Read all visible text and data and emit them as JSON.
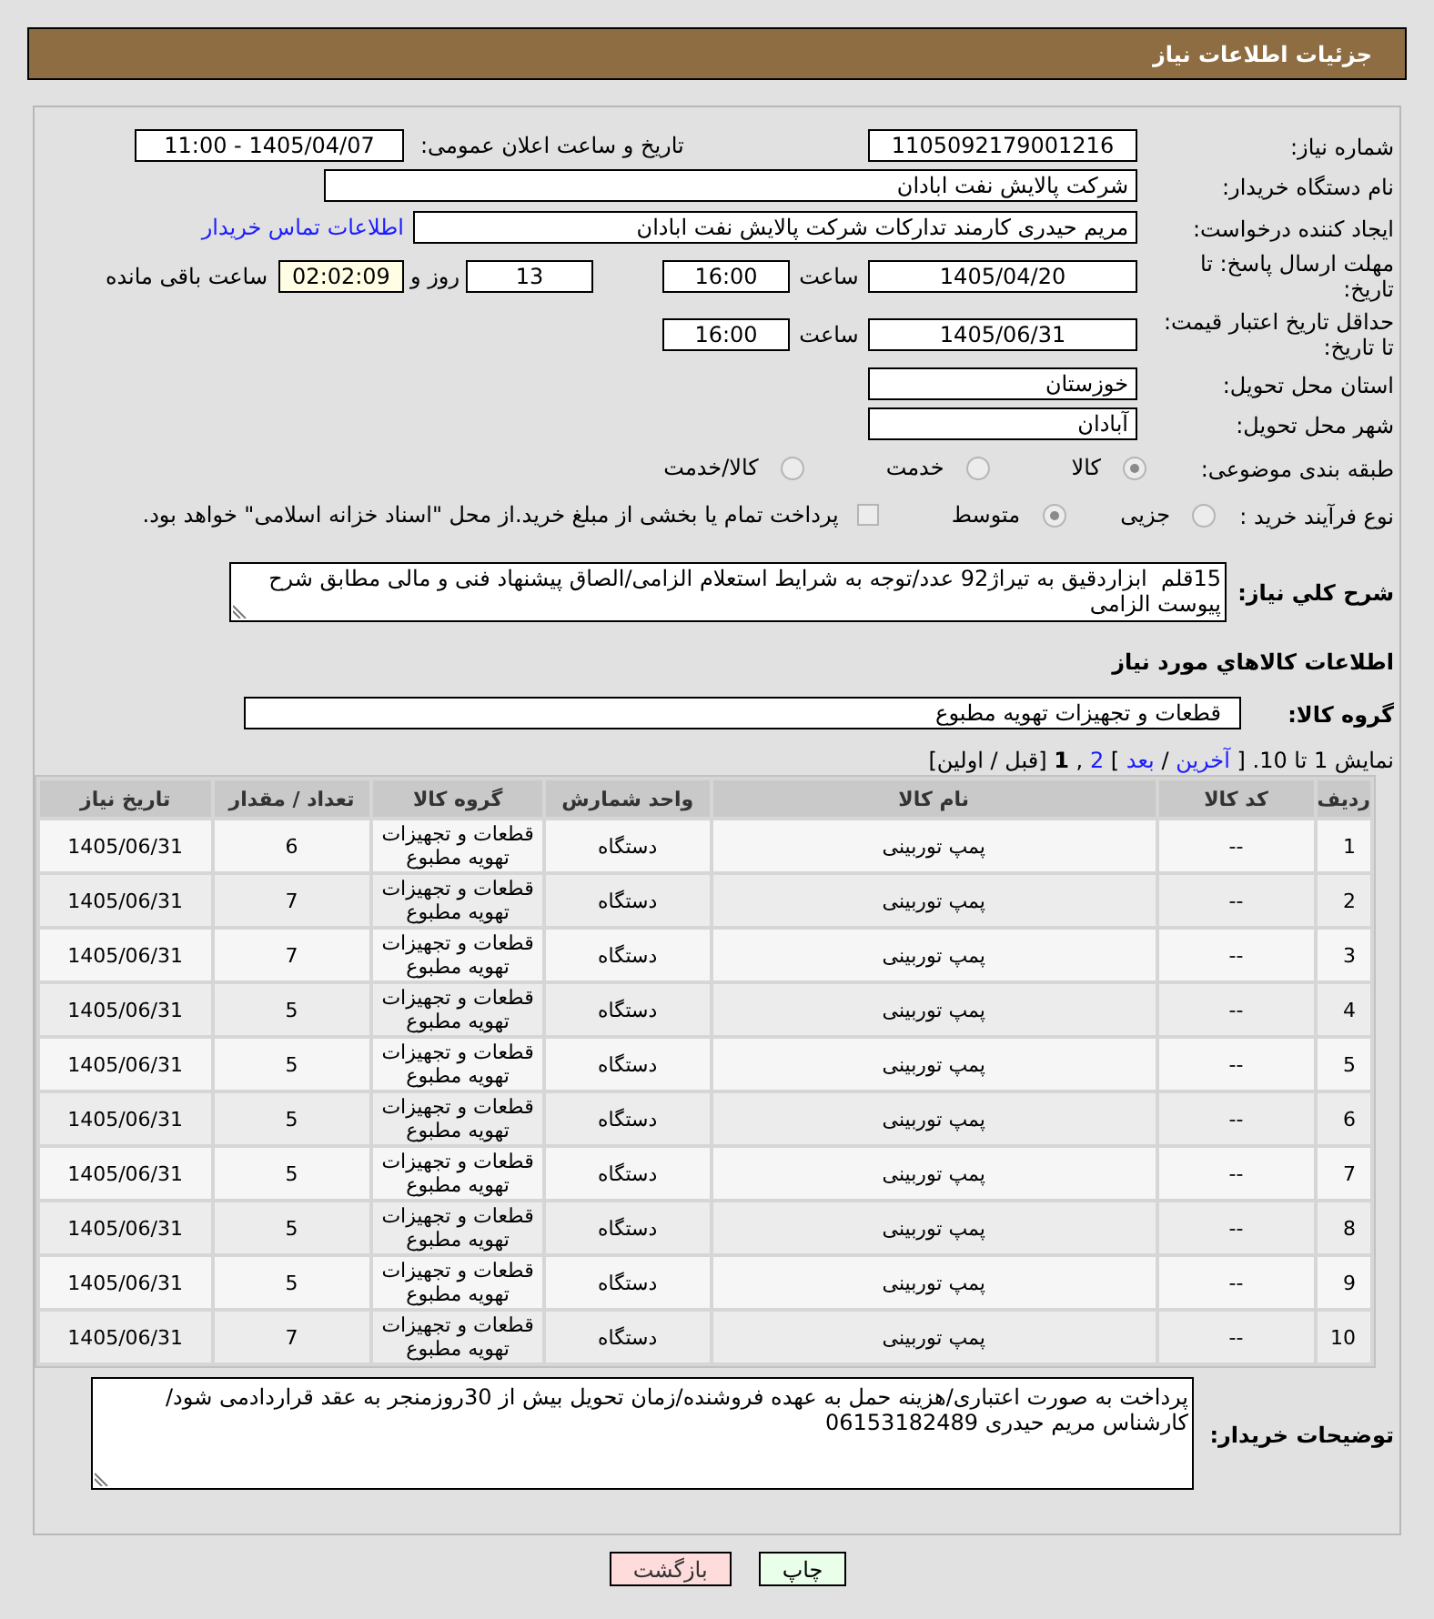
{
  "header": {
    "title": "جزئیات اطلاعات نیاز"
  },
  "need_number": {
    "label": "شماره نیاز:",
    "value": "1105092179001216"
  },
  "announcement": {
    "label": "تاریخ و ساعت اعلان عمومی:",
    "value": "1405/04/07 - 11:00"
  },
  "buyer_org": {
    "label": "نام دستگاه خریدار:",
    "value": "شرکت پالایش نفت ابادان"
  },
  "requester": {
    "label": "ایجاد کننده درخواست:",
    "value": "مریم حیدری کارمند تدارکات شرکت پالایش نفت ابادان",
    "contact_link": "اطلاعات تماس خریدار"
  },
  "response_deadline": {
    "label": "مهلت ارسال پاسخ: تا تاریخ:",
    "date": "1405/04/20",
    "time_label": "ساعت",
    "time": "16:00",
    "days": "13",
    "days_label": "روز و",
    "remaining": "02:02:09",
    "remaining_label": "ساعت باقی مانده"
  },
  "price_validity": {
    "label": "حداقل تاریخ اعتبار قیمت: تا تاریخ:",
    "date": "1405/06/31",
    "time_label": "ساعت",
    "time": "16:00"
  },
  "delivery_province": {
    "label": "استان محل تحویل:",
    "value": "خوزستان"
  },
  "delivery_city": {
    "label": "شهر محل تحویل:",
    "value": "آبادان"
  },
  "subject_category": {
    "label": "طبقه بندی موضوعی:",
    "options": [
      {
        "label": "کالا",
        "selected": true
      },
      {
        "label": "خدمت",
        "selected": false
      },
      {
        "label": "کالا/خدمت",
        "selected": false
      }
    ]
  },
  "purchase_process": {
    "label": "نوع فرآیند خرید :",
    "options": [
      {
        "label": "جزیی",
        "selected": false
      },
      {
        "label": "متوسط",
        "selected": true
      }
    ],
    "treasury_payment": {
      "label": "پرداخت تمام یا بخشی از مبلغ خرید.از محل \"اسناد خزانه اسلامی\" خواهد بود.",
      "checked": false
    }
  },
  "description": {
    "label": "شرح کلي نیاز:",
    "value": "15قلم  ابزاردقیق به تیراژ92 عدد/توجه به شرایط استعلام الزامی/الصاق پیشنهاد فنی و مالی مطابق شرح پیوست الزامی"
  },
  "items_section": {
    "title": "اطلاعات کالاهاي مورد نیاز",
    "group_label": "گروه کالا:",
    "group_value": "قطعات و تجهیزات تهویه مطبوع"
  },
  "pagination": [
    {
      "kind": "text",
      "text": "نمایش 1 تا 10. ["
    },
    {
      "kind": "link",
      "text": "آخرین"
    },
    {
      "kind": "text",
      "text": "/"
    },
    {
      "kind": "link",
      "text": "بعد"
    },
    {
      "kind": "text",
      "text": "]"
    },
    {
      "kind": "link",
      "text": "2"
    },
    {
      "kind": "text",
      "text": ","
    },
    {
      "kind": "current",
      "text": "1"
    },
    {
      "kind": "text",
      "text": "[قبل / اولین]"
    }
  ],
  "table": {
    "columns": [
      "ردیف",
      "کد کالا",
      "نام کالا",
      "واحد شمارش",
      "گروه کالا",
      "تعداد / مقدار",
      "تاریخ نیاز"
    ],
    "rows": [
      [
        "1",
        "--",
        "پمپ توربینی",
        "دستگاه",
        "قطعات و تجهیزات تهویه مطبوع",
        "6",
        "1405/06/31"
      ],
      [
        "2",
        "--",
        "پمپ توربینی",
        "دستگاه",
        "قطعات و تجهیزات تهویه مطبوع",
        "7",
        "1405/06/31"
      ],
      [
        "3",
        "--",
        "پمپ توربینی",
        "دستگاه",
        "قطعات و تجهیزات تهویه مطبوع",
        "7",
        "1405/06/31"
      ],
      [
        "4",
        "--",
        "پمپ توربینی",
        "دستگاه",
        "قطعات و تجهیزات تهویه مطبوع",
        "5",
        "1405/06/31"
      ],
      [
        "5",
        "--",
        "پمپ توربینی",
        "دستگاه",
        "قطعات و تجهیزات تهویه مطبوع",
        "5",
        "1405/06/31"
      ],
      [
        "6",
        "--",
        "پمپ توربینی",
        "دستگاه",
        "قطعات و تجهیزات تهویه مطبوع",
        "5",
        "1405/06/31"
      ],
      [
        "7",
        "--",
        "پمپ توربینی",
        "دستگاه",
        "قطعات و تجهیزات تهویه مطبوع",
        "5",
        "1405/06/31"
      ],
      [
        "8",
        "--",
        "پمپ توربینی",
        "دستگاه",
        "قطعات و تجهیزات تهویه مطبوع",
        "5",
        "1405/06/31"
      ],
      [
        "9",
        "--",
        "پمپ توربینی",
        "دستگاه",
        "قطعات و تجهیزات تهویه مطبوع",
        "5",
        "1405/06/31"
      ],
      [
        "10",
        "--",
        "پمپ توربینی",
        "دستگاه",
        "قطعات و تجهیزات تهویه مطبوع",
        "7",
        "1405/06/31"
      ]
    ]
  },
  "buyer_notes": {
    "label": "توضیحات خریدار:",
    "value": "پرداخت به صورت اعتباری/هزینه حمل به عهده فروشنده/زمان تحویل بیش از 30روزمنجر به عقد قراردادمی شود/کارشناس مریم حیدری 06153182489"
  },
  "buttons": [
    {
      "kind": "print",
      "label": "چاپ"
    },
    {
      "kind": "back",
      "label": "بازگشت"
    }
  ]
}
